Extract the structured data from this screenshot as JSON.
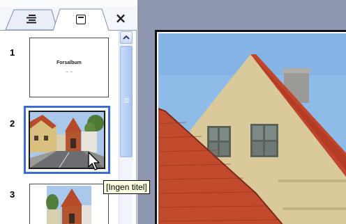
{
  "pane": {
    "tabs": [
      {
        "name": "outline",
        "icon": "outline-list-icon"
      },
      {
        "name": "slides",
        "icon": "slides-icon",
        "active": true
      }
    ],
    "close_label": "×"
  },
  "slides": [
    {
      "number": "1",
      "title_text": "Forsalbum",
      "sub_text": "→→"
    },
    {
      "number": "2",
      "selected": true
    },
    {
      "number": "3"
    }
  ],
  "tooltip": "[Ingen titel]",
  "colors": {
    "selection_border": "#3b6fcf",
    "editor_background": "#8e96b0",
    "roof_tiles": "#c0452a",
    "wall": "#d9c99b",
    "sky": "#8fbbe8"
  }
}
